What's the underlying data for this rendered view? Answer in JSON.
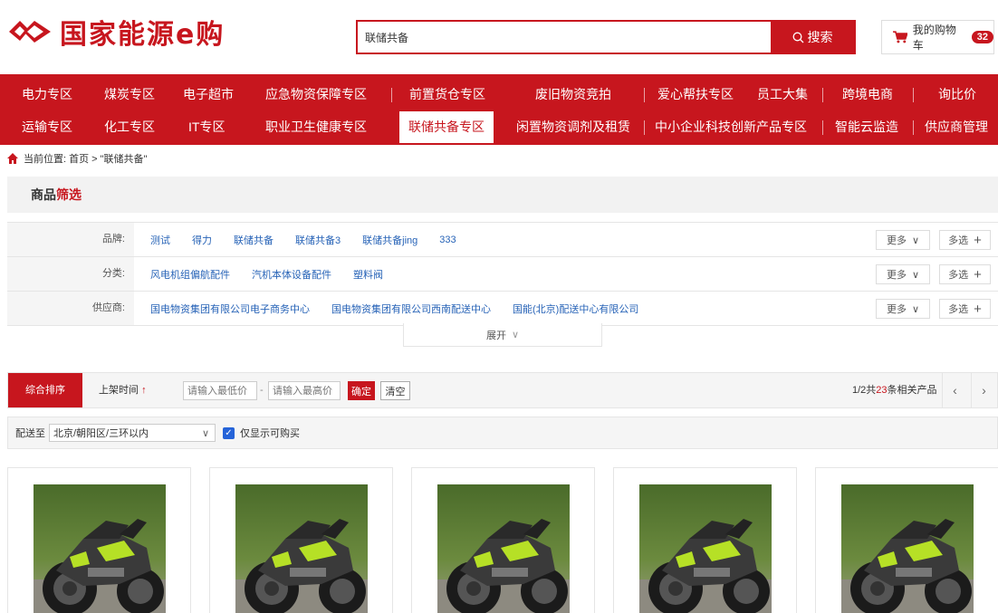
{
  "header": {
    "logo_text": "国家能源e购",
    "search": {
      "value": "联储共备",
      "button_label": "搜索"
    },
    "cart": {
      "label": "我的购物车",
      "count": "32"
    }
  },
  "nav": {
    "row1": [
      "电力专区",
      "煤炭专区",
      "电子超市",
      "应急物资保障专区",
      "前置货仓专区",
      "废旧物资竞拍",
      "爱心帮扶专区",
      "员工大集",
      "跨境电商",
      "询比价"
    ],
    "row2": [
      "运输专区",
      "化工专区",
      "IT专区",
      "职业卫生健康专区",
      "联储共备专区",
      "闲置物资调剂及租赁",
      "中小企业科技创新产品专区",
      "智能云监造",
      "供应商管理"
    ],
    "active": "联储共备专区"
  },
  "breadcrumb": {
    "text": "当前位置: 首页 > \"联储共备\""
  },
  "filter": {
    "title_a": "商品",
    "title_b": "筛选",
    "more_label": "更多",
    "multi_label": "多选",
    "expand_label": "展开",
    "rows": [
      {
        "label": "品牌:",
        "values": [
          "测试",
          "得力",
          "联储共备",
          "联储共备3",
          "联储共备jing",
          "333"
        ]
      },
      {
        "label": "分类:",
        "values": [
          "风电机组偏航配件",
          "汽机本体设备配件",
          "塑料阀"
        ]
      },
      {
        "label": "供应商:",
        "values": [
          "国电物资集团有限公司电子商务中心",
          "国电物资集团有限公司西南配送中心",
          "国能(北京)配送中心有限公司"
        ]
      }
    ]
  },
  "sort": {
    "active_label": "综合排序",
    "time_label": "上架时间",
    "min_placeholder": "请输入最低价",
    "max_placeholder": "请输入最高价",
    "confirm_label": "确定",
    "clear_label": "清空",
    "page_a": "1/2共",
    "page_count": "23",
    "page_b": "条相关产品"
  },
  "delivery": {
    "label": "配送至",
    "location": "北京/朝阳区/三环以内",
    "only_buyable": "仅显示可购买"
  },
  "products": [
    "motorcycle-image",
    "motorcycle-image",
    "motorcycle-image",
    "motorcycle-image",
    "motorcycle-image"
  ],
  "colors": {
    "brand_red": "#c7161e",
    "link_blue": "#2763b7"
  }
}
